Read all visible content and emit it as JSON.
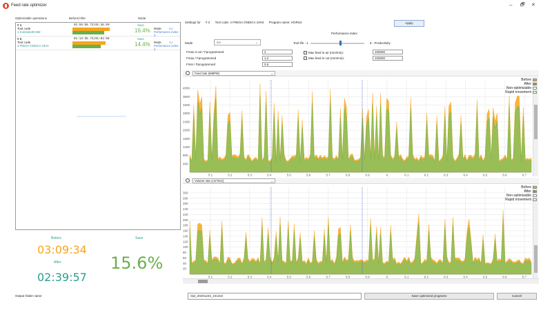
{
  "window": {
    "title": "Feed rate optimizer",
    "minimize": "–",
    "maximize": "🗗",
    "close": "✕"
  },
  "left": {
    "headers": [
      "Optimizable operations",
      "Before/After",
      "Mode"
    ],
    "operations": [
      {
        "index": "# 1",
        "tool_code_label": "Tool code",
        "tool_code_value": "1-3 alesato30 MM",
        "time": "01:55:58.73|01:36:59",
        "save_label": "Save",
        "save_value": "16.4%",
        "mode_label": "Mode",
        "mode_value": "A.I.",
        "perf": "Performance index: 3",
        "before_frac": 0.68,
        "after_frac": 0.57
      },
      {
        "index": "# 2",
        "tool_code_label": "Tool code",
        "tool_code_value": "4 FRESA ONDICA 10H4",
        "time": "01:13:35.73|01:02:58",
        "save_label": "Save",
        "save_value": "14.4%",
        "mode_label": "Mode",
        "mode_value": "A.I.",
        "perf": "Performance index: 3",
        "before_frac": 0.6,
        "after_frac": 0.51
      }
    ],
    "summary": {
      "before_label": "Before",
      "before_time": "03:09:34",
      "after_label": "After",
      "after_time": "02:39:57",
      "save_label": "Save",
      "save_value": "15.6%"
    }
  },
  "right": {
    "settings_for": "Settings for",
    "op_num": "# 2",
    "tool_code": "Tool code: 4 FRESA ONDICA 10H4",
    "program_name": "Program name: HORS2",
    "apply": "Apply",
    "perf_title": "Performance index",
    "mode_label": "Mode",
    "mode_value": "A.I.",
    "tool_life": "Tool life - 1",
    "productivity": "5 - Productivity",
    "fields": [
      {
        "label": "Fmax in air / Fprogrammed",
        "value": "2"
      },
      {
        "label": "Fmax / Fprogrammed",
        "value": "1.2"
      },
      {
        "label": "Fmin / Fprogrammed",
        "value": "0.5"
      }
    ],
    "checks": [
      {
        "label": "Max feed in air (mm/min):",
        "value": "100000"
      },
      {
        "label": "Max feed in cut (mm/min):",
        "value": "100000"
      }
    ],
    "legend": [
      "Before",
      "After",
      "Non-optimizable",
      "Rapid movement"
    ],
    "legend_colors": [
      "#f6a61c",
      "#6ab04c",
      "#ffffff",
      "#e8f6e0"
    ],
    "chart1_select": "Feed rate (MMPM)",
    "chart2_select": "Volume rate (cm³/min)",
    "output_label": "Output folder name",
    "output_value": "Opt_20201223_101322",
    "save_programs": "Save optimized programs",
    "cancel": "Cancel"
  },
  "chart_data": [
    {
      "type": "area",
      "ylabel": "",
      "ylim": [
        0,
        4400
      ],
      "yticks": [
        400,
        800,
        1200,
        1600,
        2000,
        2400,
        2800,
        3200,
        3600,
        4000
      ],
      "xticks": [
        "5.1",
        "5.2",
        "5.3",
        "5.4",
        "5.5",
        "5.6",
        "5.7",
        "5.8",
        "5.9",
        "6",
        "6.1",
        "6.2",
        "6.3",
        "6.4",
        "6.5",
        "6.6",
        "6.7"
      ],
      "series": [
        {
          "name": "Before"
        },
        {
          "name": "After"
        },
        {
          "name": "Non-optimizable"
        },
        {
          "name": "Rapid movement"
        }
      ]
    },
    {
      "type": "area",
      "ylabel": "",
      "ylim": [
        0,
        320
      ],
      "yticks": [
        20,
        40,
        60,
        80,
        100,
        120,
        140,
        160,
        180,
        200,
        220,
        240,
        260,
        280,
        300
      ],
      "xticks": [
        "5.1",
        "5.2",
        "5.3",
        "5.4",
        "5.5",
        "5.6",
        "5.7",
        "5.8",
        "5.9",
        "6",
        "6.1",
        "6.2",
        "6.3",
        "6.4",
        "6.5",
        "6.6",
        "6.7"
      ],
      "series": [
        {
          "name": "Before"
        },
        {
          "name": "After"
        },
        {
          "name": "Non-optimizable"
        },
        {
          "name": "Rapid movement"
        }
      ]
    }
  ]
}
